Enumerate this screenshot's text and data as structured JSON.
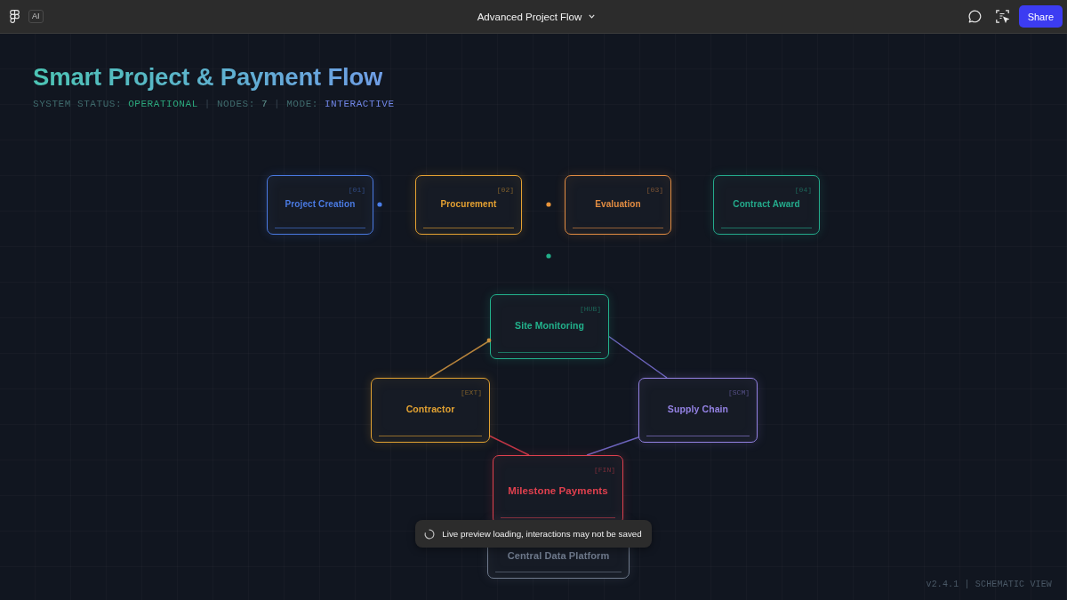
{
  "window": {
    "badge": "AI",
    "title": "Advanced Project Flow",
    "share_button": "Share"
  },
  "header": {
    "title": "Smart Project & Payment Flow",
    "status": [
      {
        "text": "SYSTEM STATUS:",
        "kind": "label"
      },
      {
        "text": "OPERATIONAL",
        "kind": "ok"
      },
      {
        "text": "|",
        "kind": "separator"
      },
      {
        "text": "NODES:",
        "kind": "label"
      },
      {
        "text": "7",
        "kind": "count"
      },
      {
        "text": "|",
        "kind": "separator"
      },
      {
        "text": "MODE:",
        "kind": "label"
      },
      {
        "text": "INTERACTIVE",
        "kind": "mode"
      }
    ]
  },
  "diagram": {
    "nodes": [
      {
        "tag": "[01]",
        "label": "Project Creation",
        "color": "#4a7ae2"
      },
      {
        "tag": "[02]",
        "label": "Procurement",
        "color": "#e6a232"
      },
      {
        "tag": "[03]",
        "label": "Evaluation",
        "color": "#e28c42"
      },
      {
        "tag": "[04]",
        "label": "Contract Award",
        "color": "#24ab8c"
      },
      {
        "tag": "[HUB]",
        "label": "Site Monitoring",
        "color": "#22b28c"
      },
      {
        "tag": "[EXT]",
        "label": "Contractor",
        "color": "#e2a232"
      },
      {
        "tag": "[SCM]",
        "label": "Supply Chain",
        "color": "#9482e4"
      },
      {
        "tag": "[FIN]",
        "label": "Milestone Payments",
        "color": "#e0404e"
      },
      {
        "label": "Central Data Platform",
        "color": "#6f7a8c"
      }
    ],
    "links": [
      {
        "color": "#b8843c"
      },
      {
        "color": "#6c64bc"
      },
      {
        "color": "#c03646"
      },
      {
        "color": "#6c64bc"
      }
    ],
    "dots": [
      {
        "color": "#4a7ee8"
      },
      {
        "color": "#e8943a"
      },
      {
        "color": "#22b08a"
      },
      {
        "color": "#c8903e"
      }
    ]
  },
  "toast": {
    "text": "Live preview loading, interactions may not be saved"
  },
  "footer": {
    "text": "v2.4.1 | SCHEMATIC VIEW"
  }
}
